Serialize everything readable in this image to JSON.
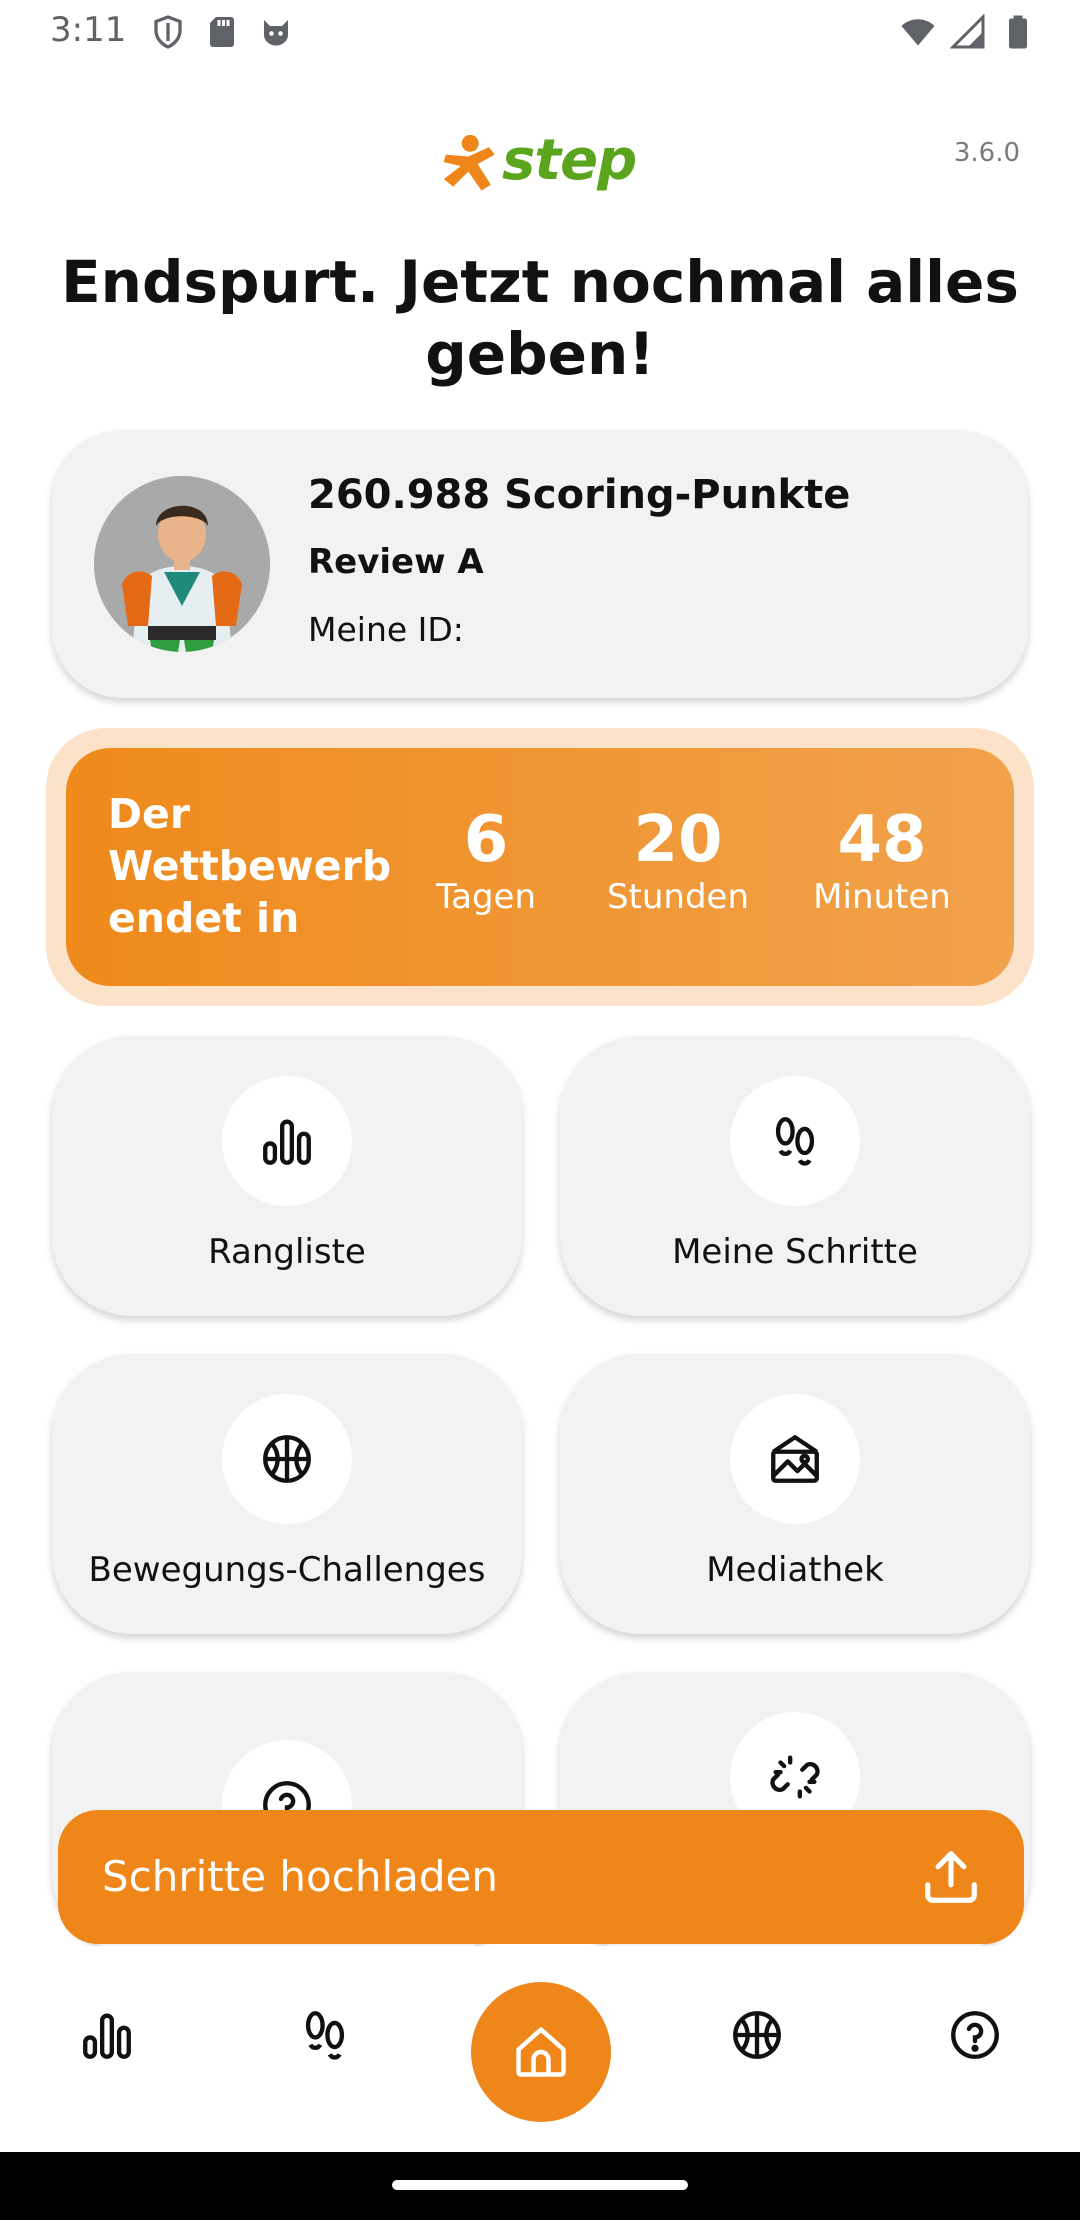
{
  "status_bar": {
    "time": "3:11",
    "left_icons": [
      "shield-icon",
      "sd-card-icon",
      "cat-face-icon"
    ],
    "right_icons": [
      "wifi-icon",
      "signal-icon",
      "battery-icon"
    ]
  },
  "header": {
    "logo_text": "step",
    "version": "3.6.0",
    "headline": "Endspurt. Jetzt nochmal alles geben!"
  },
  "profile": {
    "points": "260.988 Scoring-Punkte",
    "name": "Review A",
    "id_label": "Meine ID:"
  },
  "countdown": {
    "label": "Der Wettbewerb endet in",
    "days": "6",
    "days_label": "Tagen",
    "hours": "20",
    "hours_label": "Stunden",
    "minutes": "48",
    "minutes_label": "Minuten"
  },
  "tiles": [
    {
      "label": "Rangliste",
      "icon": "leaderboard-icon"
    },
    {
      "label": "Meine Schritte",
      "icon": "footprints-icon"
    },
    {
      "label": "Bewegungs-Challenges",
      "icon": "basketball-icon"
    },
    {
      "label": "Mediathek",
      "icon": "media-library-icon"
    },
    {
      "label": "",
      "icon": "help-icon"
    },
    {
      "label": "",
      "icon": "broken-link-icon"
    }
  ],
  "upload_button": {
    "label": "Schritte hochladen",
    "icon": "upload-icon"
  },
  "bottom_nav": {
    "items": [
      "leaderboard-icon",
      "footprints-icon",
      "home-icon",
      "basketball-icon",
      "help-icon"
    ],
    "active": "home-icon"
  },
  "colors": {
    "accent_orange": "#ee8619",
    "logo_green": "#5aa51d",
    "card_gray": "#f2f2f2"
  }
}
